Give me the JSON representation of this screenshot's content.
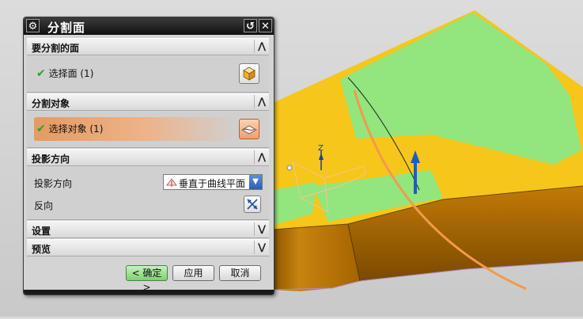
{
  "dialog": {
    "title": "分割面",
    "sections": {
      "face_to_split": {
        "title": "要分割的面",
        "select_label": "选择面 (1)"
      },
      "split_object": {
        "title": "分割对象",
        "select_label": "选择对象 (1)"
      },
      "projection": {
        "title": "投影方向",
        "direction_label": "投影方向",
        "direction_value": "垂直于曲线平面",
        "reverse_label": "反向"
      },
      "settings": {
        "title": "设置"
      },
      "preview": {
        "title": "预览"
      }
    },
    "buttons": {
      "ok": "< 确定 >",
      "apply": "应用",
      "cancel": "取消"
    }
  },
  "viewport": {
    "axis_label": "Z"
  },
  "colors": {
    "face_yellow": "#f5c518",
    "face_green": "#8fe07c",
    "side_brown": "#b06a00",
    "curve_orange": "#f39a4a",
    "vector_blue": "#1f5fb8"
  }
}
